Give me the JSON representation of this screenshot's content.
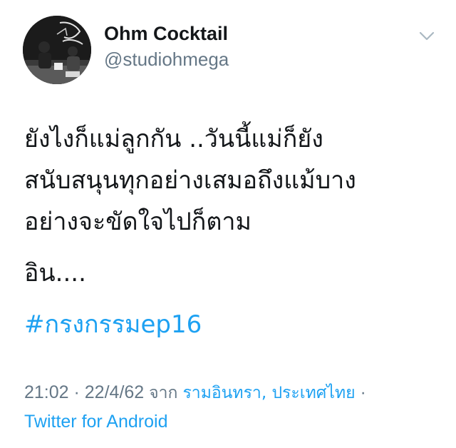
{
  "author": {
    "display_name": "Ohm Cocktail",
    "handle": "@studiohmega"
  },
  "tweet": {
    "lines": [
      "ยังไงก็แม่ลูกกัน ..วันนี้แม่ก็ยัง",
      "สนับสนุนทุกอย่างเสมอถึงแม้บาง",
      "อย่างจะขัดใจไปก็ตาม",
      "อิน...."
    ],
    "hashtag": "#กรงกรรมep16"
  },
  "meta": {
    "time": "21:02",
    "separator": " · ",
    "date": "22/4/62",
    "from_word": "จาก",
    "location": "รามอินทรา, ประเทศไทย",
    "separator_end": " ·",
    "source": "Twitter for Android"
  },
  "colors": {
    "link": "#1da1f2",
    "secondary_text": "#657786",
    "primary_text": "#14171a"
  },
  "icons": {
    "menu": "chevron-down-icon",
    "avatar": "profile-photo"
  }
}
